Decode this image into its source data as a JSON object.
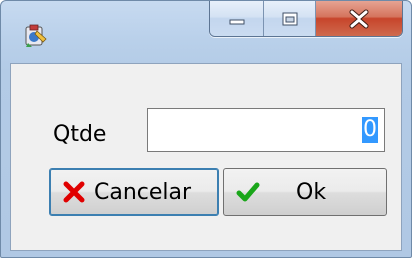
{
  "window": {
    "icons": {
      "app": "app-icon",
      "minimize": "minimize-icon",
      "maximize": "maximize-icon",
      "close": "close-icon"
    }
  },
  "form": {
    "qtde_label": "Qtde",
    "qtde_value": "0"
  },
  "buttons": {
    "cancel_label": "Cancelar",
    "cancel_icon": "red-x-icon",
    "ok_label": "Ok",
    "ok_icon": "green-check-icon"
  },
  "colors": {
    "close_button": "#c7452b",
    "selection": "#3399ff",
    "cancel_icon": "#e00000",
    "ok_icon": "#1aa61a"
  }
}
